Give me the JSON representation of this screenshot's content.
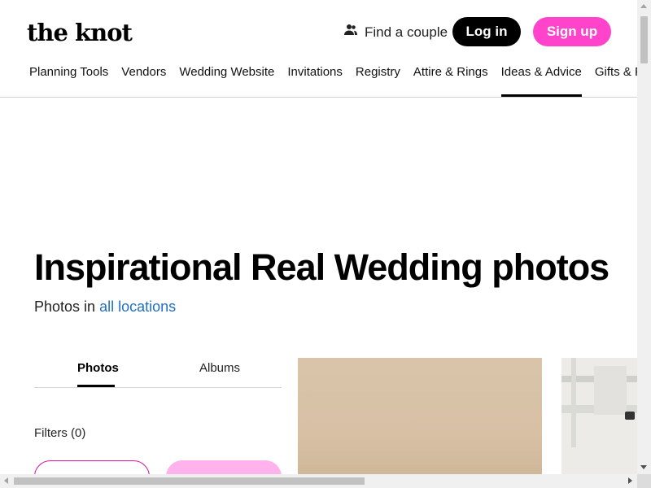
{
  "header": {
    "logo": "the knot",
    "find_couple": "Find a couple",
    "login": "Log in",
    "signup": "Sign up"
  },
  "nav": [
    {
      "label": "Planning Tools"
    },
    {
      "label": "Vendors"
    },
    {
      "label": "Wedding Website"
    },
    {
      "label": "Invitations"
    },
    {
      "label": "Registry"
    },
    {
      "label": "Attire & Rings"
    },
    {
      "label": "Ideas & Advice",
      "active": true
    },
    {
      "label": "Gifts & Favors"
    }
  ],
  "main": {
    "title": "Inspirational Real Wedding photos",
    "subtitle_prefix": "Photos in",
    "subtitle_link": "all locations",
    "tabs": [
      "Photos",
      "Albums"
    ],
    "filters": "Filters (0)"
  },
  "colors": {
    "brand_pink": "#ff44cb",
    "link_blue": "#1f6fc5"
  }
}
